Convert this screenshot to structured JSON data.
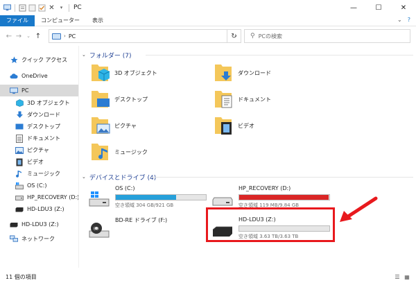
{
  "window": {
    "title": "PC",
    "minimize_glyph": "—",
    "maximize_glyph": "☐",
    "close_glyph": "✕"
  },
  "ribbon": {
    "tabs": [
      "ファイル",
      "コンピューター",
      "表示"
    ]
  },
  "address": {
    "crumb": "PC",
    "search_placeholder": "PCの検索"
  },
  "sidebar": {
    "items": [
      {
        "label": "クイック アクセス",
        "icon": "star-icon"
      },
      {
        "label": "OneDrive",
        "icon": "cloud-icon"
      },
      {
        "label": "PC",
        "icon": "computer-icon"
      },
      {
        "label": "3D オブジェクト",
        "icon": "3d-objects-icon"
      },
      {
        "label": "ダウンロード",
        "icon": "download-icon"
      },
      {
        "label": "デスクトップ",
        "icon": "desktop-icon"
      },
      {
        "label": "ドキュメント",
        "icon": "document-icon"
      },
      {
        "label": "ピクチャ",
        "icon": "pictures-icon"
      },
      {
        "label": "ビデオ",
        "icon": "video-icon"
      },
      {
        "label": "ミュージック",
        "icon": "music-icon"
      },
      {
        "label": "OS (C:)",
        "icon": "os-drive-icon"
      },
      {
        "label": "HP_RECOVERY (D:)",
        "icon": "drive-icon"
      },
      {
        "label": "HD-LDU3 (Z:)",
        "icon": "external-drive-icon"
      },
      {
        "label": "HD-LDU3 (Z:)",
        "icon": "external-drive-icon"
      },
      {
        "label": "ネットワーク",
        "icon": "network-icon"
      }
    ]
  },
  "folders_group": {
    "title": "フォルダー (7)",
    "items": [
      {
        "label": "3D オブジェクト",
        "icon": "3d-objects-icon"
      },
      {
        "label": "ダウンロード",
        "icon": "download-icon"
      },
      {
        "label": "デスクトップ",
        "icon": "desktop-icon"
      },
      {
        "label": "ドキュメント",
        "icon": "document-icon"
      },
      {
        "label": "ピクチャ",
        "icon": "pictures-icon"
      },
      {
        "label": "ビデオ",
        "icon": "video-icon"
      },
      {
        "label": "ミュージック",
        "icon": "music-icon"
      }
    ]
  },
  "drives_group": {
    "title": "デバイスとドライブ (4)",
    "items": [
      {
        "name": "OS (C:)",
        "space": "空き領域 304 GB/921 GB",
        "used_fraction": 0.67,
        "bar_color": "#26a0da",
        "icon": "os-drive-icon"
      },
      {
        "name": "HP_RECOVERY (D:)",
        "space": "空き領域 119 MB/9.84 GB",
        "used_fraction": 0.99,
        "bar_color": "#da2626",
        "icon": "drive-icon"
      },
      {
        "name": "BD-RE ドライブ (F:)",
        "icon": "bd-drive-icon"
      },
      {
        "name": "HD-LDU3 (Z:)",
        "space": "空き領域 3.63 TB/3.63 TB",
        "used_fraction": 0.0,
        "bar_color": "#26a0da",
        "icon": "external-drive-icon"
      }
    ]
  },
  "status": {
    "item_count": "11 個の項目"
  },
  "colors": {
    "accent": "#1979ca",
    "group_header": "#1e3f93",
    "highlight": "#e8191d"
  }
}
